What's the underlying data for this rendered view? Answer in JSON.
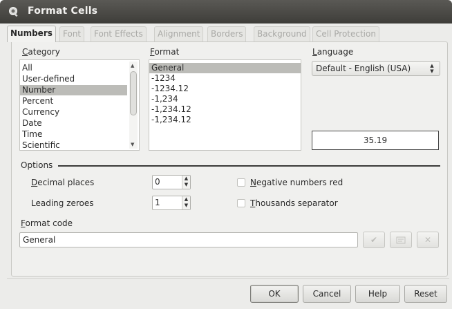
{
  "window": {
    "title": "Format Cells"
  },
  "tabs": [
    {
      "label": "Numbers",
      "active": true
    },
    {
      "label": "Font"
    },
    {
      "label": "Font Effects"
    },
    {
      "label": "Alignment"
    },
    {
      "label": "Borders"
    },
    {
      "label": "Background"
    },
    {
      "label": "Cell Protection"
    }
  ],
  "category": {
    "label": "Category",
    "items": [
      "All",
      "User-defined",
      "Number",
      "Percent",
      "Currency",
      "Date",
      "Time",
      "Scientific"
    ],
    "selected": "Number"
  },
  "format": {
    "label": "Format",
    "items": [
      "General",
      "-1234",
      "-1234.12",
      "-1,234",
      "-1,234.12",
      "-1,234.12"
    ],
    "selected": "General"
  },
  "language": {
    "label": "Language",
    "value": "Default - English (USA)"
  },
  "preview": {
    "value": "35.19"
  },
  "options": {
    "title": "Options",
    "decimal_places": {
      "label": "Decimal places",
      "value": "0"
    },
    "leading_zeroes": {
      "label": "Leading zeroes",
      "value": "1"
    },
    "negative_red": {
      "label": "Negative numbers red",
      "checked": false
    },
    "thousands_separator": {
      "label": "Thousands separator",
      "checked": false
    }
  },
  "format_code": {
    "label": "Format code",
    "value": "General"
  },
  "buttons": {
    "ok": "OK",
    "cancel": "Cancel",
    "help": "Help",
    "reset": "Reset"
  }
}
